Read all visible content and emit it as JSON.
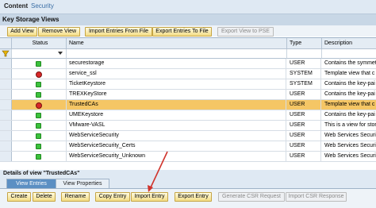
{
  "header": {
    "content": "Content",
    "security": "Security"
  },
  "title": "Key Storage Views",
  "toolbar": [
    {
      "label": "Add View",
      "enabled": true
    },
    {
      "label": "Remove View",
      "enabled": true
    },
    {
      "label": "Import Entries From File",
      "enabled": true
    },
    {
      "label": "Export Entries To File",
      "enabled": true
    },
    {
      "label": "Export View to PSE",
      "enabled": false
    }
  ],
  "table": {
    "columns": {
      "status": "Status",
      "name": "Name",
      "type": "Type",
      "description": "Description"
    },
    "rows": [
      {
        "status": "green",
        "name": "securestorage",
        "type": "USER",
        "description": "Contains the symmet"
      },
      {
        "status": "red",
        "name": "service_ssl",
        "type": "SYSTEM",
        "description": "Template view that c"
      },
      {
        "status": "green",
        "name": "TicketKeystore",
        "type": "SYSTEM",
        "description": "Contains the key-pai"
      },
      {
        "status": "green",
        "name": "TREXKeyStore",
        "type": "USER",
        "description": "Contains the key-pai"
      },
      {
        "status": "red",
        "name": "TrustedCAs",
        "type": "USER",
        "description": "Template view that c",
        "selected": true
      },
      {
        "status": "green",
        "name": "UMEKeystore",
        "type": "USER",
        "description": "Contains the key-pai"
      },
      {
        "status": "green",
        "name": "VMware-VASL",
        "type": "USER",
        "description": "This is a view for stor"
      },
      {
        "status": "green",
        "name": "WebServiceSecurity",
        "type": "USER",
        "description": "Web Services Securit"
      },
      {
        "status": "green",
        "name": "WebServiceSecurity_Certs",
        "type": "USER",
        "description": "Web Services Securit"
      },
      {
        "status": "green",
        "name": "WebServiceSecurity_Unknown",
        "type": "USER",
        "description": "Web Services Securit"
      }
    ]
  },
  "details": {
    "title": "Details of view \"TrustedCAs\"",
    "tabs": [
      {
        "label": "View Entries",
        "active": true
      },
      {
        "label": "View Properties",
        "active": false
      }
    ],
    "buttons": [
      {
        "label": "Create",
        "enabled": true
      },
      {
        "label": "Delete",
        "enabled": true
      },
      {
        "label": "Rename",
        "enabled": true
      },
      {
        "label": "Copy Entry",
        "enabled": true
      },
      {
        "label": "Import Entry",
        "enabled": true
      },
      {
        "label": "Export Entry",
        "enabled": true
      },
      {
        "label": "Generate CSR Request",
        "enabled": false
      },
      {
        "label": "Import CSR Response",
        "enabled": false
      }
    ]
  },
  "colors": {
    "selected_row": "#f5c665",
    "status_green": "#3cc13c",
    "status_red": "#d82828",
    "arrow": "#d0342c"
  }
}
